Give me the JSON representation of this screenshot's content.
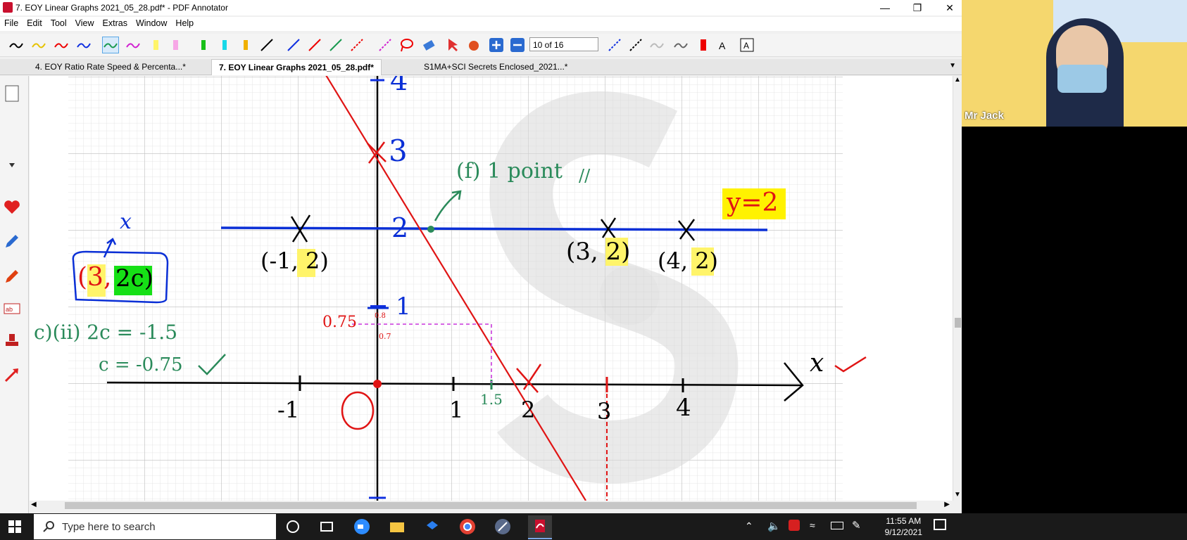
{
  "window": {
    "title": "7. EOY Linear Graphs 2021_05_28.pdf* - PDF Annotator"
  },
  "menu": [
    "File",
    "Edit",
    "Tool",
    "View",
    "Extras",
    "Window",
    "Help"
  ],
  "toolbar": {
    "page_indicator": "10 of 16"
  },
  "tabs": [
    {
      "label": "4. EOY Ratio Rate Speed & Percenta...*",
      "active": false
    },
    {
      "label": "7. EOY Linear Graphs 2021_05_28.pdf*",
      "active": true
    },
    {
      "label": "S1MA+SCI Secrets Enclosed_2021...*",
      "active": false
    }
  ],
  "document": {
    "y_axis_labels": [
      "4",
      "3",
      "2",
      "1"
    ],
    "x_axis_labels": [
      "-1",
      "1",
      "1.5",
      "2",
      "3",
      "4"
    ],
    "origin_label": "O",
    "x_axis_name": "x",
    "point_labels": [
      "(-1, 2)",
      "(3, 2)",
      "(4, 2)"
    ],
    "line_label": "y=2",
    "f_annotation": "(f) 1 point",
    "f_mark": "//",
    "box_expr_left": "(3,",
    "box_expr_right": "2c)",
    "box_x": "x",
    "work_line1": "c)(ii) 2c = -1.5",
    "work_line2": "c = -0.75",
    "y_readoff": "0.75",
    "y_ticks_small_top": "0.8",
    "y_ticks_small_bottom": "0.7"
  },
  "webcam": {
    "name": "Mr Jack"
  },
  "taskbar": {
    "search_placeholder": "Type here to search",
    "time": "11:55 AM",
    "date": "9/12/2021"
  },
  "colors": {
    "accent_blue": "#0a2fd6",
    "annotation_red": "#e01414",
    "annotation_green": "#2a8a5a",
    "highlight_yellow": "#fff200",
    "highlight_green": "#16e016"
  }
}
